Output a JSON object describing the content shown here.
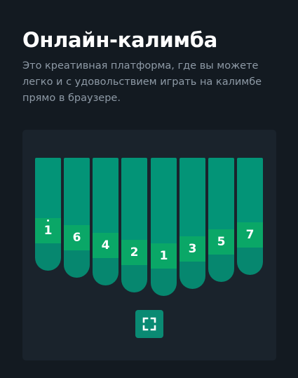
{
  "header": {
    "title": "Онлайн-калимба",
    "description": "Это креативная платформа, где вы можете легко и с удовольствием играть на калимбе прямо в браузере."
  },
  "kalimba": {
    "colors": {
      "tine_upper": "#039477",
      "tine_band": "#0aa767",
      "tine_lower": "#06876f",
      "button": "#0a8a73",
      "button_icon": "#ffffff"
    },
    "tines": [
      {
        "note": "1",
        "dot": true
      },
      {
        "note": "6",
        "dot": false
      },
      {
        "note": "4",
        "dot": false
      },
      {
        "note": "2",
        "dot": false
      },
      {
        "note": "1",
        "dot": false
      },
      {
        "note": "3",
        "dot": false
      },
      {
        "note": "5",
        "dot": false
      },
      {
        "note": "7",
        "dot": false
      }
    ],
    "fullscreen_button": {
      "icon": "fullscreen-icon"
    }
  }
}
